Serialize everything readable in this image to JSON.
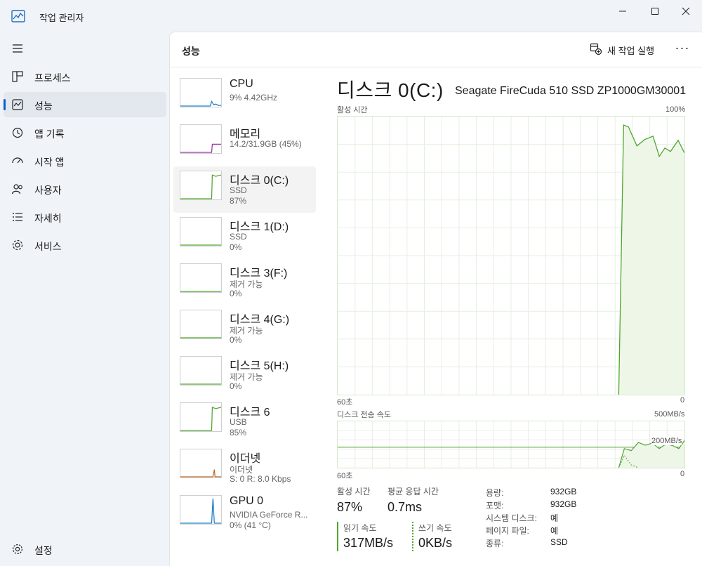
{
  "window": {
    "title": "작업 관리자"
  },
  "sidebar": {
    "items": [
      {
        "label": "프로세스",
        "icon": "processes-icon"
      },
      {
        "label": "성능",
        "icon": "performance-icon",
        "active": true
      },
      {
        "label": "앱 기록",
        "icon": "app-history-icon"
      },
      {
        "label": "시작 앱",
        "icon": "startup-apps-icon"
      },
      {
        "label": "사용자",
        "icon": "users-icon"
      },
      {
        "label": "자세히",
        "icon": "details-icon"
      },
      {
        "label": "서비스",
        "icon": "services-icon"
      }
    ],
    "settings_label": "설정"
  },
  "header": {
    "title": "성능",
    "run_task_label": "새 작업 실행",
    "more_label": "···"
  },
  "devices": [
    {
      "name": "CPU",
      "sub": "9% 4.42GHz",
      "val": "",
      "color": "#1e7fc8",
      "usage": 0.09
    },
    {
      "name": "메모리",
      "sub": "14.2/31.9GB (45%)",
      "val": "",
      "color": "#9b2fae",
      "usage": 0.45
    },
    {
      "name": "디스크 0(C:)",
      "sub": "SSD",
      "val": "87%",
      "color": "#4ea72e",
      "usage": 0.87,
      "selected": true
    },
    {
      "name": "디스크 1(D:)",
      "sub": "SSD",
      "val": "0%",
      "color": "#4ea72e",
      "usage": 0
    },
    {
      "name": "디스크 3(F:)",
      "sub": "제거 가능",
      "val": "0%",
      "color": "#4ea72e",
      "usage": 0
    },
    {
      "name": "디스크 4(G:)",
      "sub": "제거 가능",
      "val": "0%",
      "color": "#4ea72e",
      "usage": 0
    },
    {
      "name": "디스크 5(H:)",
      "sub": "제거 가능",
      "val": "0%",
      "color": "#4ea72e",
      "usage": 0
    },
    {
      "name": "디스크 6",
      "sub": "USB",
      "val": "85%",
      "color": "#4ea72e",
      "usage": 0.85
    },
    {
      "name": "이더넷",
      "sub": "이더넷",
      "val": "S: 0 R: 8.0 Kbps",
      "color": "#b86a2f",
      "usage": 0.3
    },
    {
      "name": "GPU 0",
      "sub": "NVIDIA GeForce R...",
      "val": "0% (41 °C)",
      "color": "#1e7fc8",
      "usage": 0.7
    }
  ],
  "detail": {
    "title": "디스크 0(C:)",
    "model": "Seagate FireCuda 510 SSD ZP1000GM30001",
    "active_time_label": "활성 시간",
    "active_time_max": "100%",
    "active_time_xmin": "60초",
    "active_time_xmax": "0",
    "transfer_label": "디스크 전송 속도",
    "transfer_max": "500MB/s",
    "transfer_mid": "200MB/s",
    "transfer_xmin": "60초",
    "transfer_xmax": "0",
    "stats": {
      "active_label": "활성 시간",
      "active_value": "87%",
      "response_label": "평균 응답 시간",
      "response_value": "0.7ms",
      "read_label": "읽기 속도",
      "read_value": "317MB/s",
      "write_label": "쓰기 속도",
      "write_value": "0KB/s"
    },
    "props": [
      {
        "label": "용량:",
        "value": "932GB"
      },
      {
        "label": "포맷:",
        "value": "932GB"
      },
      {
        "label": "시스템 디스크:",
        "value": "예"
      },
      {
        "label": "페이지 파일:",
        "value": "예"
      },
      {
        "label": "종류:",
        "value": "SSD"
      }
    ]
  },
  "colors": {
    "accent": "#0a63c7",
    "disk_line": "#4ea72e",
    "disk_fill": "#eef6e8",
    "grid": "#e6efe1"
  }
}
